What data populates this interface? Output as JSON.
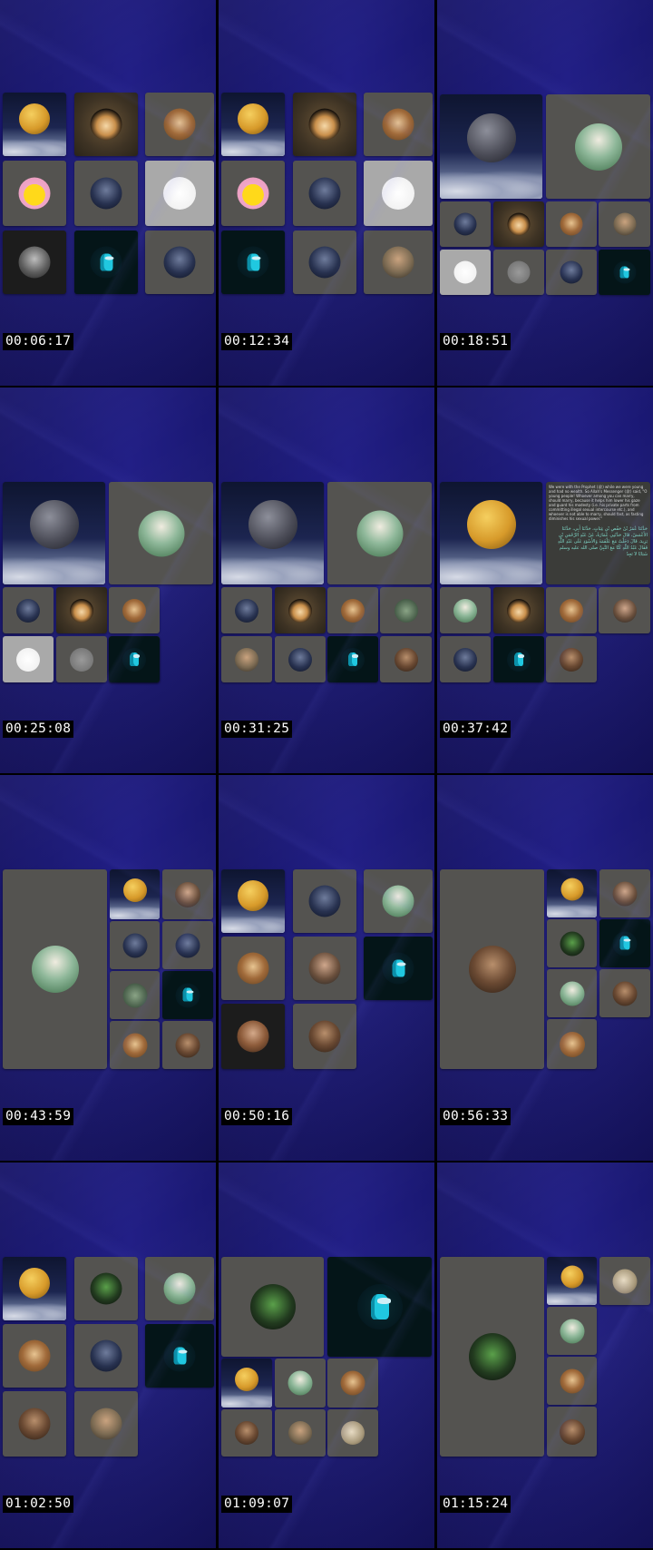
{
  "sheet": {
    "columns": 3,
    "rows": 4,
    "background": "#1a1873"
  },
  "frames": [
    {
      "timestamp": "00:06:17",
      "tiles": [
        "moon",
        "hands",
        "jar",
        "simpson",
        "hooded",
        "calligraphy",
        "portrait-bw",
        "among-us",
        "hooded"
      ]
    },
    {
      "timestamp": "00:12:34",
      "tiles": [
        "moon",
        "hands",
        "jar",
        "simpson",
        "hooded",
        "calligraphy",
        "among-us",
        "hooded",
        "girl"
      ]
    },
    {
      "timestamp": "00:18:51",
      "tiles": [
        "moon-dark",
        "sheikh",
        "hooded",
        "hands",
        "jar",
        "girl",
        "calligraphy",
        "grey",
        "hooded",
        "among-us"
      ]
    },
    {
      "timestamp": "00:25:08",
      "tiles": [
        "moon-dark",
        "sheikh",
        "hooded",
        "hands",
        "jar",
        "calligraphy",
        "grey",
        "hooded",
        "among-us"
      ]
    },
    {
      "timestamp": "00:31:25",
      "tiles": [
        "moon-dark",
        "sheikh",
        "hooded",
        "hands",
        "jar",
        "landscape",
        "girl",
        "hooded",
        "among-us",
        "curls"
      ]
    },
    {
      "timestamp": "00:37:42",
      "tiles": [
        "moon",
        "quote",
        "sheikh",
        "hands",
        "jar",
        "man",
        "hooded",
        "among-us",
        "curls"
      ],
      "quote": {
        "english": "We were with the Prophet (ﷺ) while we were young and had no wealth. So Allah's Messenger (ﷺ) said, \"O young people! Whoever among you can marry, should marry, because it helps him lower his gaze and guard his modesty (i.e. his private parts from committing illegal sexual intercourse etc.), and whoever is not able to marry, should fast, as fasting diminishes his sexual power.\"",
        "arabic": "حَدَّثَنَا عُمَرُ بْنُ حَفْصِ بْنِ غِيَاثٍ، حَدَّثَنَا أَبِي، حَدَّثَنَا الأَعْمَشُ، قَالَ حَدَّثَنِي عُمَارَةُ، عَنْ عَبْدِ الرَّحْمَنِ بْنِ يَزِيدَ، قَالَ دَخَلْتُ مَعَ عَلْقَمَةَ وَالأَسْوَدِ عَلَى عَبْدِ اللَّهِ فَقَالَ عَبْدُ اللَّهِ كُنَّا مَعَ النَّبِيِّ صلى الله عليه وسلم شَبَابًا لاَ نَجِدُ"
      }
    },
    {
      "timestamp": "00:43:59",
      "tiles": [
        "sheikh",
        "moon",
        "man",
        "hooded",
        "hooded",
        "landscape",
        "among-us",
        "jar",
        "curls"
      ]
    },
    {
      "timestamp": "00:50:16",
      "tiles": [
        "moon",
        "hooded",
        "sheikh",
        "jar",
        "man",
        "among-us",
        "woman",
        "curls"
      ]
    },
    {
      "timestamp": "00:56:33",
      "tiles": [
        "curls",
        "moon",
        "man",
        "green",
        "among-us",
        "sheikh",
        "curls",
        "jar"
      ]
    },
    {
      "timestamp": "01:02:50",
      "tiles": [
        "moon",
        "green",
        "sheikh",
        "jar",
        "hooded",
        "among-us",
        "curls",
        "girl"
      ]
    },
    {
      "timestamp": "01:09:07",
      "tiles": [
        "green",
        "among-us",
        "moon",
        "sheikh",
        "jar",
        "curls",
        "girl",
        "medal"
      ]
    },
    {
      "timestamp": "01:15:24",
      "tiles": [
        "green",
        "moon",
        "medal",
        "sheikh",
        "jar",
        "curls"
      ]
    }
  ]
}
